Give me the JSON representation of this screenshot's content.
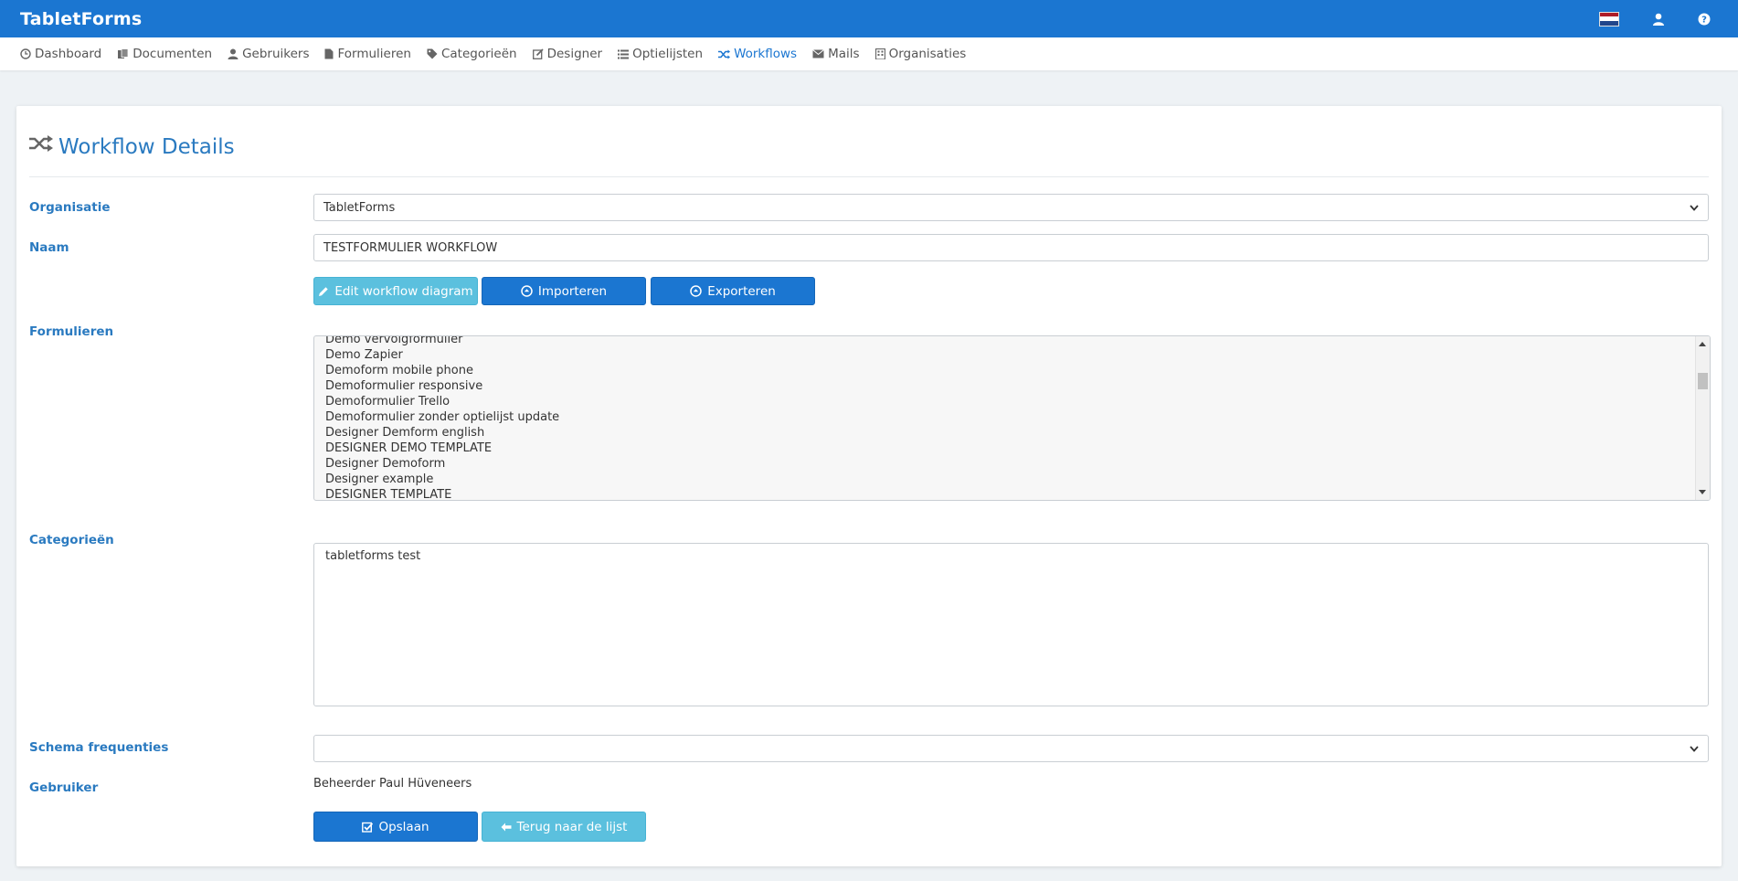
{
  "app": {
    "title": "TabletForms"
  },
  "nav": [
    {
      "label": "Dashboard",
      "icon": "clock-icon"
    },
    {
      "label": "Documenten",
      "icon": "documents-icon"
    },
    {
      "label": "Gebruikers",
      "icon": "user-icon"
    },
    {
      "label": "Formulieren",
      "icon": "file-icon"
    },
    {
      "label": "Categorieën",
      "icon": "tag-icon"
    },
    {
      "label": "Designer",
      "icon": "edit-icon"
    },
    {
      "label": "Optielijsten",
      "icon": "list-icon"
    },
    {
      "label": "Workflows",
      "icon": "shuffle-icon",
      "active": true
    },
    {
      "label": "Mails",
      "icon": "mail-icon"
    },
    {
      "label": "Organisaties",
      "icon": "building-icon"
    }
  ],
  "page": {
    "title": "Workflow Details"
  },
  "form": {
    "organisatie": {
      "label": "Organisatie",
      "value": "TabletForms"
    },
    "naam": {
      "label": "Naam",
      "value": "TESTFORMULIER WORKFLOW"
    },
    "buttons": {
      "edit_diagram": "Edit workflow diagram",
      "import": "Importeren",
      "export": "Exporteren"
    },
    "formulieren": {
      "label": "Formulieren",
      "items": [
        "Demo vervolgformulier",
        "Demo Zapier",
        "Demoform mobile phone",
        "Demoformulier responsive",
        "Demoformulier Trello",
        "Demoformulier zonder optielijst update",
        "Designer Demform english",
        "DESIGNER DEMO TEMPLATE",
        "Designer Demoform",
        "Designer example",
        "DESIGNER TEMPLATE"
      ]
    },
    "categorieen": {
      "label": "Categorieën",
      "items": [
        "tabletforms test"
      ]
    },
    "schema": {
      "label": "Schema frequenties",
      "value": ""
    },
    "gebruiker": {
      "label": "Gebruiker",
      "value": "Beheerder Paul Hüveneers"
    },
    "actions": {
      "save": "Opslaan",
      "back": "Terug naar de lijst"
    }
  },
  "colors": {
    "brand": "#1b76d1",
    "info": "#5bc0de",
    "label": "#2a7ac0"
  }
}
